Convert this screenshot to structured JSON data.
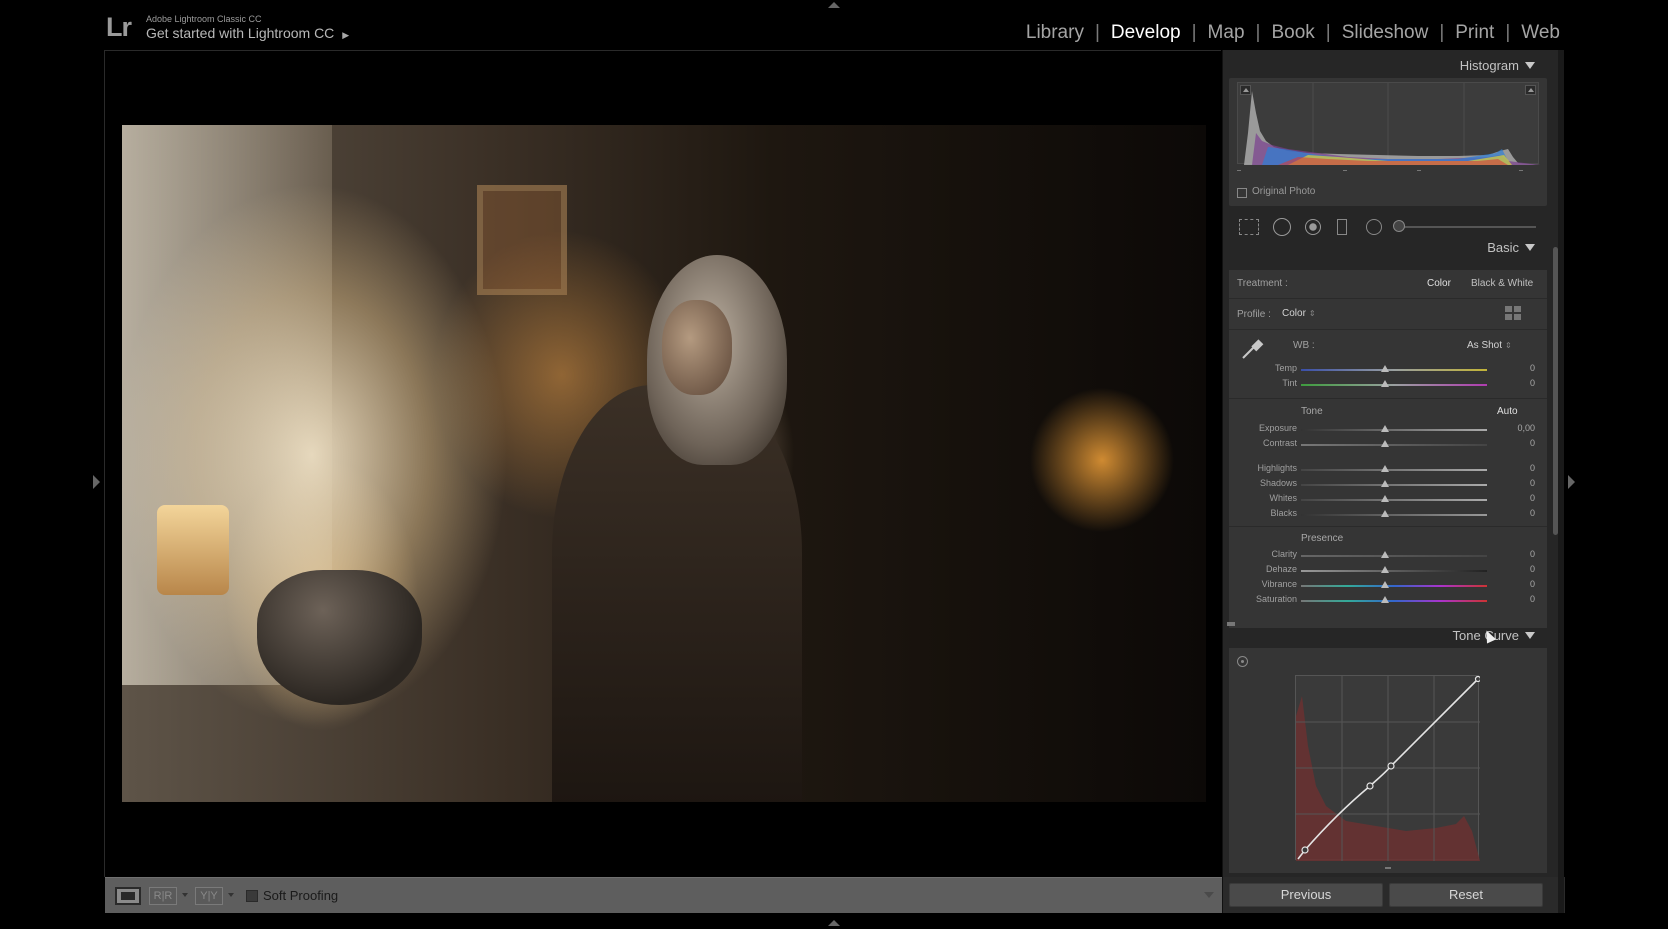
{
  "app": {
    "logo": "Lr",
    "product": "Adobe Lightroom Classic CC",
    "subtitle": "Get started with Lightroom CC"
  },
  "modules": [
    "Library",
    "Develop",
    "Map",
    "Book",
    "Slideshow",
    "Print",
    "Web"
  ],
  "active_module": "Develop",
  "toolbar": {
    "soft_proofing_label": "Soft Proofing",
    "soft_proofing_checked": false
  },
  "histogram": {
    "title": "Histogram",
    "original_photo_label": "Original Photo"
  },
  "basic": {
    "title": "Basic",
    "treatment_label": "Treatment :",
    "treatment_color": "Color",
    "treatment_bw": "Black & White",
    "profile_label": "Profile :",
    "profile_value": "Color",
    "wb_label": "WB :",
    "wb_value": "As Shot",
    "temp": {
      "name": "Temp",
      "value": "0"
    },
    "tint": {
      "name": "Tint",
      "value": "0"
    },
    "tone_title": "Tone",
    "auto_label": "Auto",
    "exposure": {
      "name": "Exposure",
      "value": "0,00"
    },
    "contrast": {
      "name": "Contrast",
      "value": "0"
    },
    "highlights": {
      "name": "Highlights",
      "value": "0"
    },
    "shadows": {
      "name": "Shadows",
      "value": "0"
    },
    "whites": {
      "name": "Whites",
      "value": "0"
    },
    "blacks": {
      "name": "Blacks",
      "value": "0"
    },
    "presence_title": "Presence",
    "clarity": {
      "name": "Clarity",
      "value": "0"
    },
    "dehaze": {
      "name": "Dehaze",
      "value": "0"
    },
    "vibrance": {
      "name": "Vibrance",
      "value": "0"
    },
    "saturation": {
      "name": "Saturation",
      "value": "0"
    }
  },
  "tone_curve": {
    "title": "Tone Curve"
  },
  "buttons": {
    "previous": "Previous",
    "reset": "Reset"
  }
}
